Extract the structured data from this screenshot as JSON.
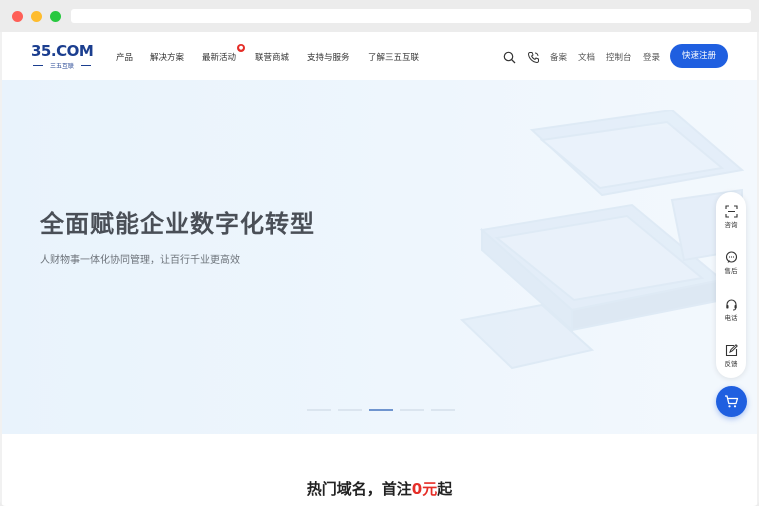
{
  "logo": {
    "text": "35.COM",
    "subtitle": "三五互联"
  },
  "nav": {
    "items": [
      {
        "label": "产品"
      },
      {
        "label": "解决方案"
      },
      {
        "label": "最新活动"
      },
      {
        "label": "联营商城"
      },
      {
        "label": "支持与服务"
      },
      {
        "label": "了解三五互联"
      }
    ]
  },
  "utility": {
    "icons": [
      "search-icon",
      "phone-icon"
    ],
    "links": [
      "备案",
      "文档",
      "控制台",
      "登录"
    ],
    "register_label": "快速注册"
  },
  "hero": {
    "title": "全面赋能企业数字化转型",
    "subtitle": "人财物事一体化协同管理，让百行千业更高效",
    "slide_count": 5,
    "active_slide": 3
  },
  "float_bar": {
    "items": [
      {
        "label": "咨询",
        "icon": "scan-icon"
      },
      {
        "label": "售后",
        "icon": "chat-icon"
      },
      {
        "label": "电话",
        "icon": "headset-icon"
      },
      {
        "label": "反馈",
        "icon": "feedback-icon"
      }
    ],
    "cart_icon": "cart-icon"
  },
  "section": {
    "title_pre": "热门域名，首注",
    "title_accent": "0元",
    "title_post": "起"
  },
  "colors": {
    "brand_blue": "#1f5fe0",
    "accent_red": "#e52d27",
    "hero_bg": "#eaf4fc"
  }
}
